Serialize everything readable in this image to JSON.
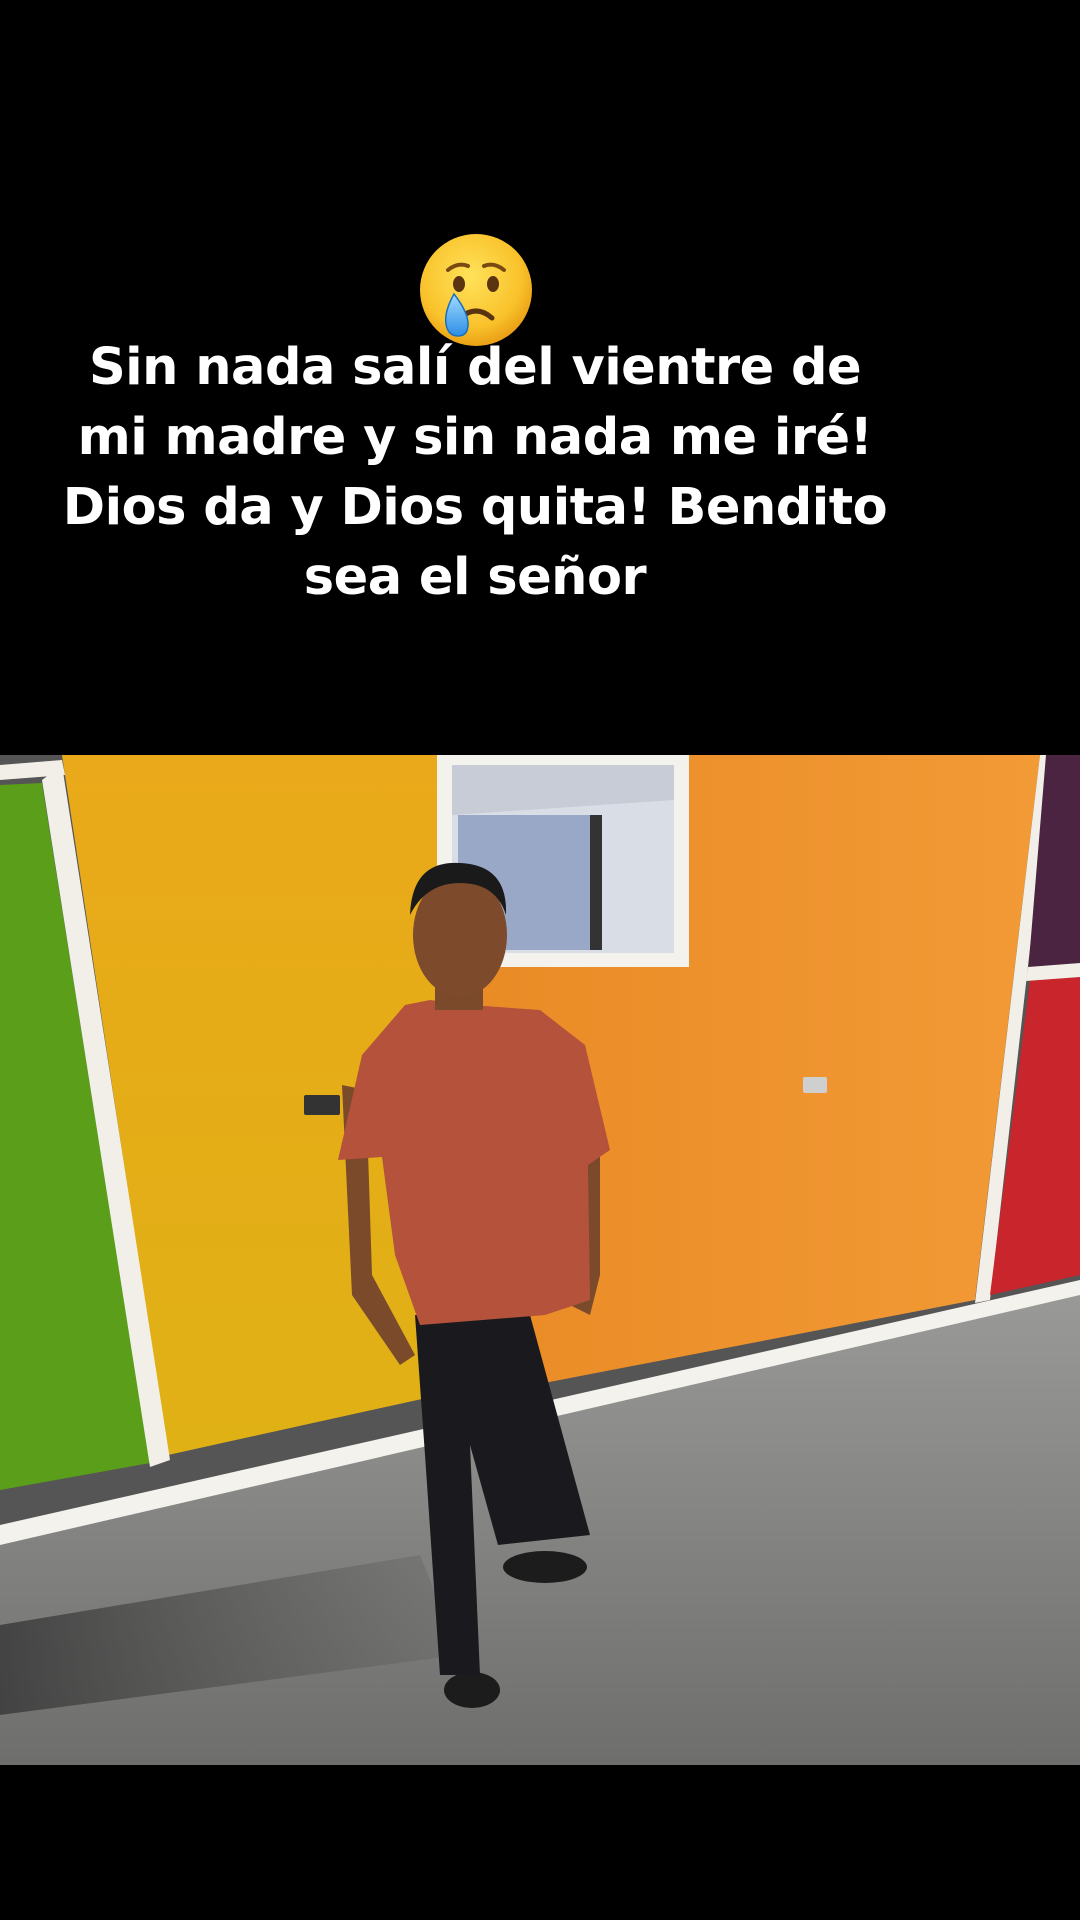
{
  "post": {
    "emoji": "crying-face-icon",
    "caption": "Sin nada salí del vientre de mi madre y sin nada me iré! Dios da y Dios quita! Bendito sea el señor"
  },
  "photo": {
    "description_colors": {
      "wall_green": "#5a9e1a",
      "wall_yellow": "#e6b416",
      "wall_orange": "#ee8a2a",
      "wall_red": "#c8262c",
      "wall_purple": "#4a2440",
      "floor": "#8a8a88",
      "shirt": "#b5523c"
    }
  }
}
